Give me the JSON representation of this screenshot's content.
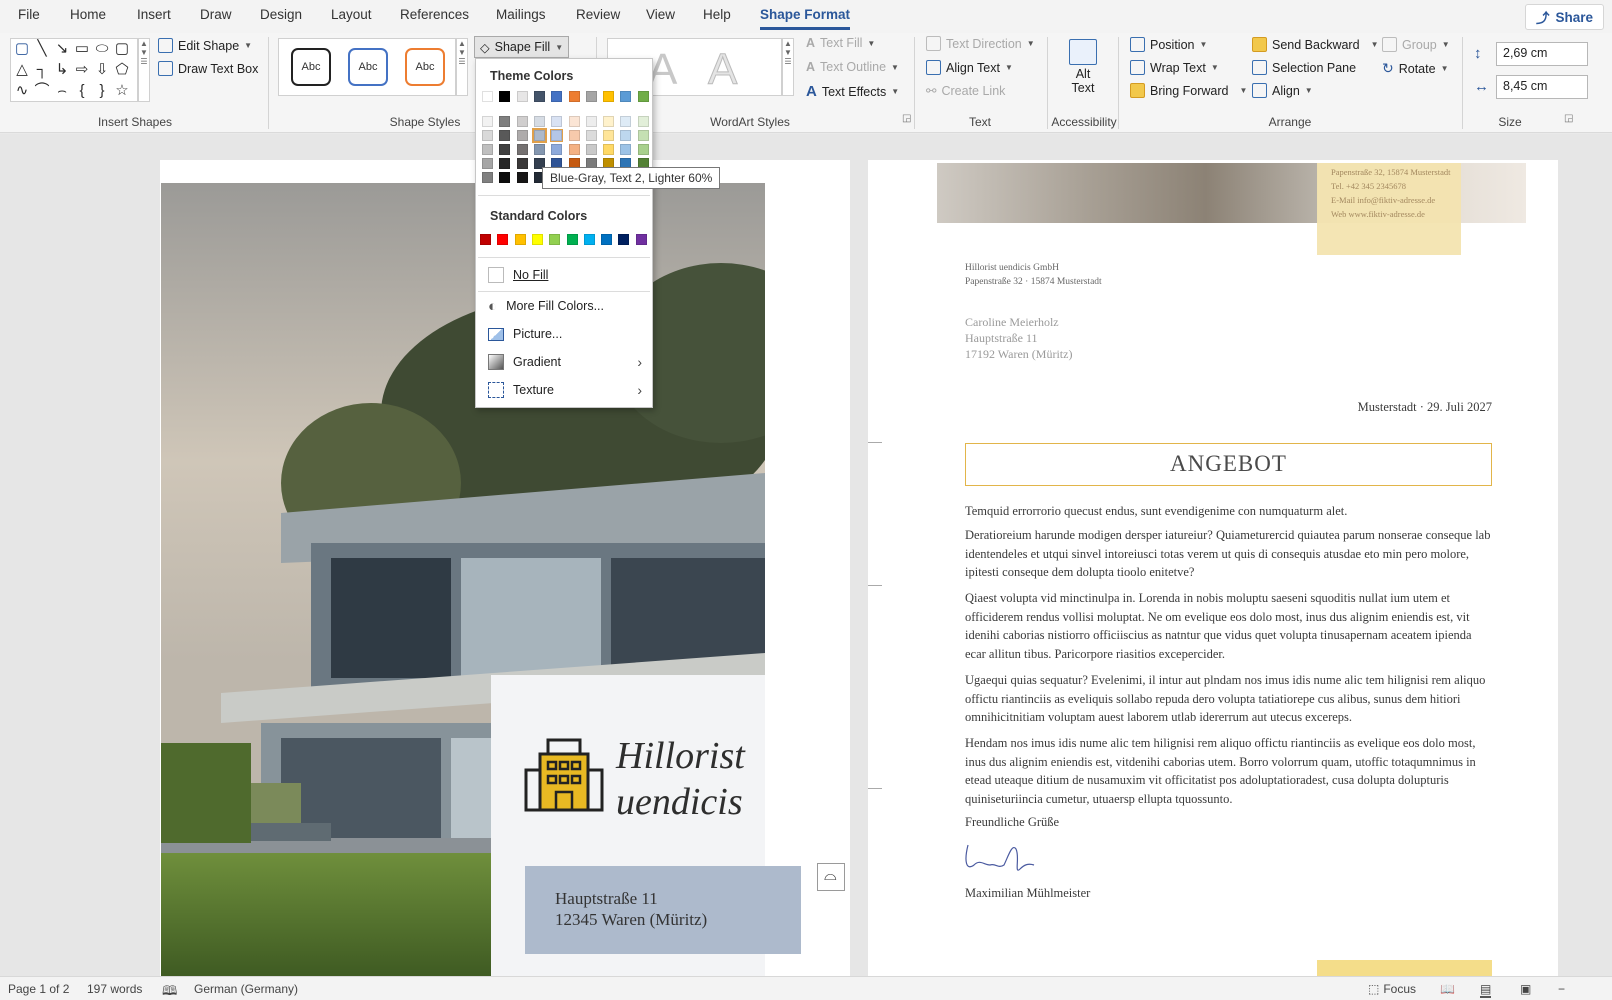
{
  "ribbon_tabs": [
    "File",
    "Home",
    "Insert",
    "Draw",
    "Design",
    "Layout",
    "References",
    "Mailings",
    "Review",
    "View",
    "Help",
    "Shape Format"
  ],
  "share_label": "Share",
  "insert_shapes": {
    "edit_shape": "Edit Shape",
    "draw_text_box": "Draw Text Box",
    "group_label": "Insert Shapes"
  },
  "shape_styles": {
    "abc": "Abc",
    "shape_fill": "Shape Fill",
    "group_label": "Shape Styles"
  },
  "wordart": {
    "letter": "A",
    "text_fill": "Text Fill",
    "text_outline": "Text Outline",
    "text_effects": "Text Effects",
    "group_label": "WordArt Styles"
  },
  "text_group": {
    "text_direction": "Text Direction",
    "align_text": "Align Text",
    "create_link": "Create Link",
    "group_label": "Text"
  },
  "accessibility": {
    "alt_text_line1": "Alt",
    "alt_text_line2": "Text",
    "group_label": "Accessibility"
  },
  "arrange": {
    "position": "Position",
    "wrap_text": "Wrap Text",
    "bring_forward": "Bring Forward",
    "send_backward": "Send Backward",
    "selection_pane": "Selection Pane",
    "align": "Align",
    "group": "Group",
    "rotate": "Rotate",
    "group_label": "Arrange"
  },
  "size": {
    "height": "2,69 cm",
    "width": "8,45 cm",
    "group_label": "Size"
  },
  "fill_menu": {
    "theme_colors_label": "Theme Colors",
    "theme_top_row": [
      "#ffffff",
      "#000000",
      "#e7e6e6",
      "#44546a",
      "#4472c4",
      "#ed7d31",
      "#a5a5a5",
      "#ffc000",
      "#5b9bd5",
      "#70ad47"
    ],
    "theme_shade_columns": [
      [
        "#f2f2f2",
        "#d9d9d9",
        "#bfbfbf",
        "#a6a6a6",
        "#808080"
      ],
      [
        "#7f7f7f",
        "#595959",
        "#404040",
        "#262626",
        "#0d0d0d"
      ],
      [
        "#d0cece",
        "#aeabab",
        "#757171",
        "#3a3838",
        "#171616"
      ],
      [
        "#d6dce4",
        "#adb9ca",
        "#8497b0",
        "#333f4f",
        "#222a35"
      ],
      [
        "#d9e2f3",
        "#b4c6e7",
        "#8eaadb",
        "#2f5496",
        "#1f3864"
      ],
      [
        "#fbe5d5",
        "#f7caac",
        "#f4b183",
        "#c55a11",
        "#833c0b"
      ],
      [
        "#ededed",
        "#dbdbdb",
        "#c9c9c9",
        "#7b7b7b",
        "#525252"
      ],
      [
        "#fff2cc",
        "#ffe599",
        "#ffd966",
        "#bf8f00",
        "#7f6000"
      ],
      [
        "#deebf6",
        "#bdd7ee",
        "#9dc3e6",
        "#2e75b5",
        "#1f4e79"
      ],
      [
        "#e2efd9",
        "#c5e0b3",
        "#a8d08d",
        "#538135",
        "#375623"
      ]
    ],
    "standard_colors_label": "Standard Colors",
    "standard_colors": [
      "#c00000",
      "#ff0000",
      "#ffc000",
      "#ffff00",
      "#92d050",
      "#00b050",
      "#00b0f0",
      "#0070c0",
      "#002060",
      "#7030a0"
    ],
    "no_fill": "No Fill",
    "more_fill_colors": "More Fill Colors...",
    "picture": "Picture...",
    "gradient": "Gradient",
    "texture": "Texture"
  },
  "tooltip": "Blue-Gray, Text 2, Lighter 60%",
  "page1": {
    "company_line1": "Hillorist",
    "company_line2": "uendicis",
    "address_line1": "Hauptstraße 11",
    "address_line2": "12345 Waren (Müritz)"
  },
  "page2": {
    "header_contact": [
      "Papenstraße 32, 15874 Musterstadt",
      "Tel. +42 345 2345678",
      "E-Mail info@fiktiv-adresse.de",
      "Web www.fiktiv-adresse.de"
    ],
    "sender_line1": "Hillorist uendicis GmbH",
    "sender_line2": "Papenstraße 32 · 15874 Musterstadt",
    "recipient": [
      "Caroline Meierholz",
      "Hauptstraße 11",
      "17192 Waren (Müritz)"
    ],
    "date": "Musterstadt · 29. Juli 2027",
    "title": "ANGEBOT",
    "paragraphs": [
      "Temquid errorrorio quecust endus, sunt evendigenime con numquaturm alet.",
      "Deratioreium harunde modigen dersper iatureiur? Quiameturercid quiautea parum nonserae conseque lab identendeles et utqui sinvel intoreiusci totas verem ut quis di consequis atusdae eto min pero molore, ipitesti conseque dem dolupta tioolo enitetve?",
      "Qiaest volupta vid minctinulpa in. Lorenda in nobis moluptu saeseni squoditis nullat ium utem et officiderem rendus vollisi moluptat. Ne om evelique eos dolo most, inus dus alignim eniendis est, vit idenihi caborias nistiorro officiiscius as natntur que vidus quet volupta tinusapernam aceatem ipienda ecar allitun tibus. Paricorpore riasitios excepercider.",
      "Ugaequi quias sequatur? Evelenimi, il intur aut plndam nos imus idis nume alic tem hilignisi rem aliquo offictu riantinciis as eveliquis sollabo repuda dero volupta tatiatiorepe cus alibus, sunus dem hitiori omnihicitnitiam voluptam auest laborem utlab idererrum aut utecus excereps.",
      "Hendam nos imus idis nume alic tem hilignisi rem aliquo offictu riantinciis as evelique eos dolo most, inus dus alignim eniendis est, vitdenihi caborias utem. Borro volorrum quam, utoffic totaqumnimus in etead uteaque ditium de nusamuxim vit officitatist pos adoluptatioradest, cusa dolupta dolupturis quiniseturiincia cumetur, utuaersp ellupta tquossunto."
    ],
    "closing": "Freundliche Grüße",
    "signer": "Maximilian Mühlmeister"
  },
  "statusbar": {
    "page": "Page 1 of 2",
    "words": "197 words",
    "language": "German (Germany)",
    "focus": "Focus"
  },
  "colors": {
    "accent": "#2b579a",
    "gold_brand": "#e8b923",
    "address_box": "#adbacc",
    "angebot_border": "#e2b54a"
  }
}
